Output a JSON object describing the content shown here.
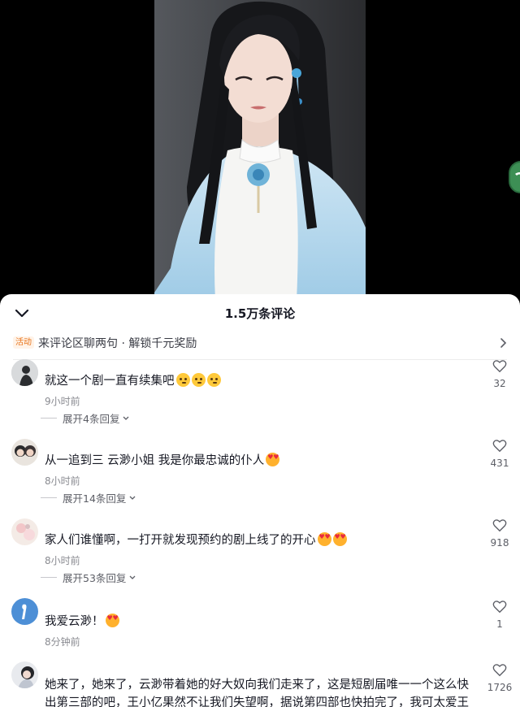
{
  "colors": {
    "sheet_bg": "#ffffff",
    "text_primary": "#161823",
    "text_secondary": "#8a8b91",
    "promo_accent": "#e8731a",
    "video_bg": "#000000"
  },
  "sheet": {
    "title": "1.5万条评论",
    "collapse_icon": "chevron-down-icon"
  },
  "promo": {
    "tag": "活动",
    "text": "来评论区聊两句 · 解锁千元奖励",
    "arrow_icon": "chevron-right-icon"
  },
  "comments": [
    {
      "text": "就这一个剧一直有续集吧",
      "emojis": [
        "thinking-emoji",
        "thinking-emoji",
        "thinking-emoji"
      ],
      "time": "9小时前",
      "replies": "展开4条回复",
      "likes": "32"
    },
    {
      "text": "从一追到三 云渺小姐 我是你最忠诚的仆人",
      "emojis": [
        "heart-eyes-emoji"
      ],
      "time": "8小时前",
      "replies": "展开14条回复",
      "likes": "431"
    },
    {
      "text": "家人们谁懂啊，一打开就发现预约的剧上线了的开心",
      "emojis": [
        "heart-eyes-emoji",
        "heart-eyes-emoji"
      ],
      "time": "8小时前",
      "replies": "展开53条回复",
      "likes": "918"
    },
    {
      "text": "我爱云渺！",
      "emojis": [
        "heart-eyes-emoji"
      ],
      "time": "8分钟前",
      "replies": "",
      "likes": "1"
    },
    {
      "text": "她来了，她来了，云渺带着她的好大奴向我们走来了，这是短剧届唯一一个这么快出第三部的吧，王小亿果然不让我们失望啊，据说第四部也快拍完了，我可太爱王",
      "emojis": [],
      "time": "",
      "replies": "",
      "likes": "1726"
    }
  ]
}
